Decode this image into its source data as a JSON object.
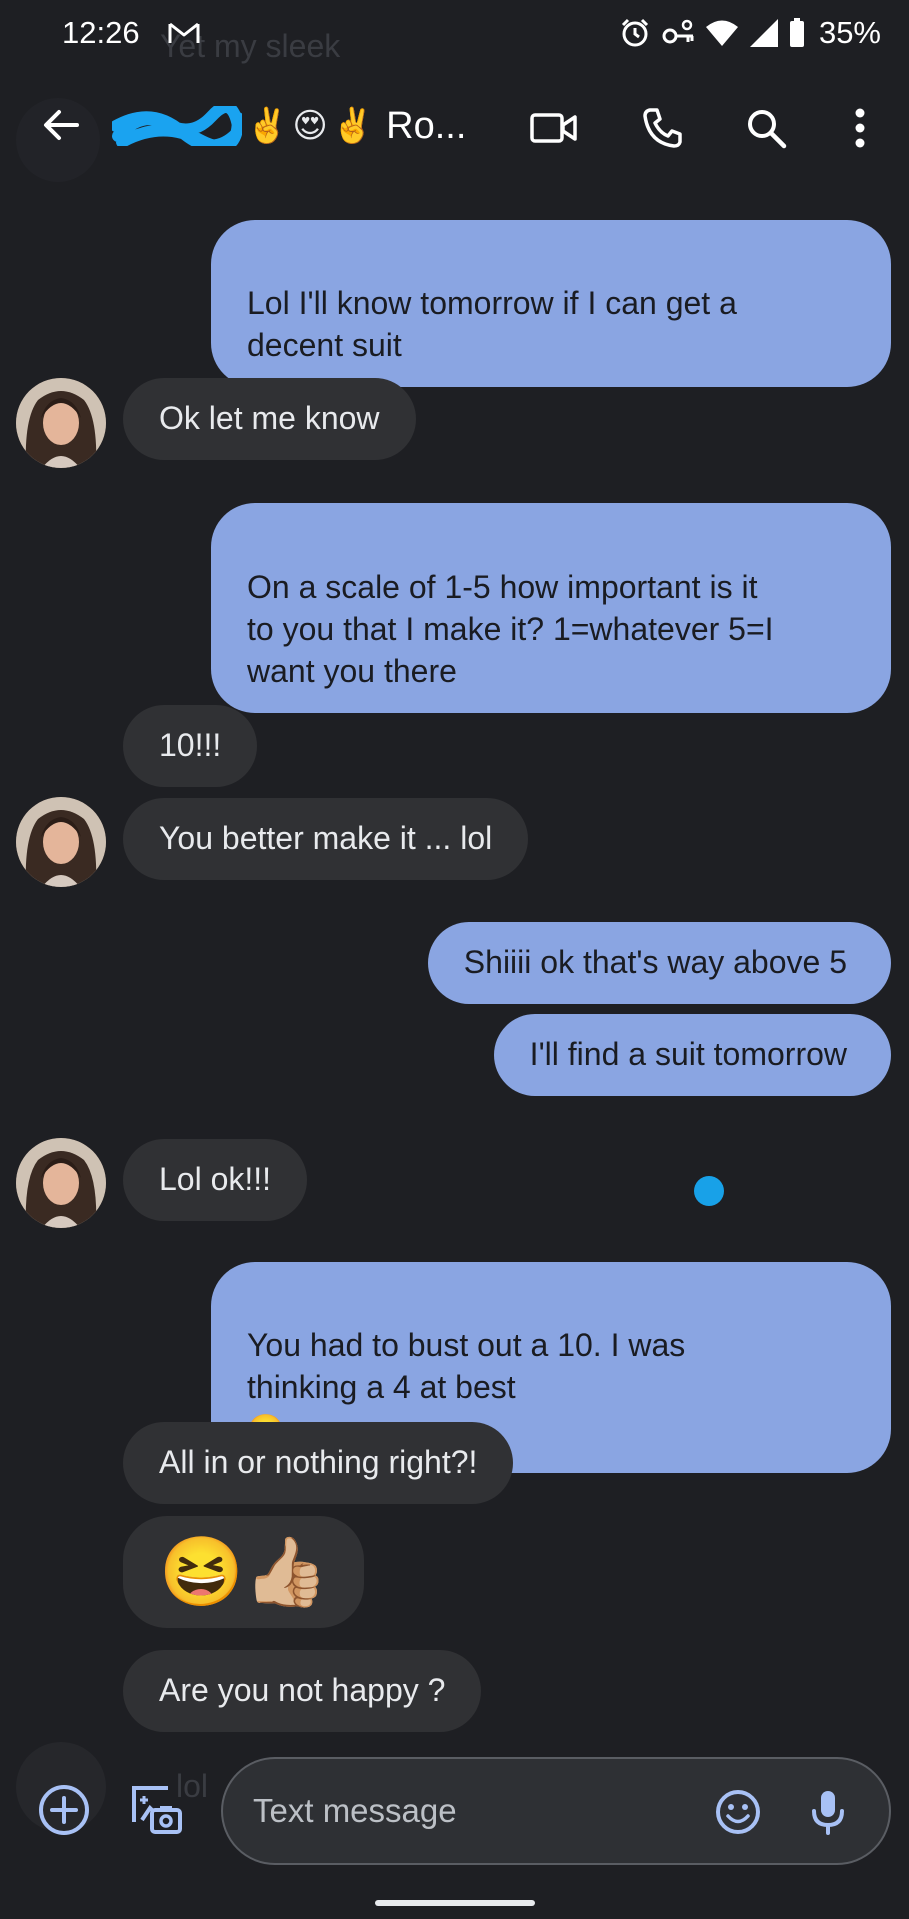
{
  "status_bar": {
    "time": "12:26",
    "battery": "35%",
    "icons": [
      "gmail-icon",
      "alarm-icon",
      "vpn-key-icon",
      "wifi-icon",
      "signal-icon",
      "battery-icon"
    ]
  },
  "header": {
    "ghost_text": "Yet my sleek",
    "contact_name": "Ro...",
    "name_emojis": [
      "✌️",
      "😍",
      "✌️"
    ],
    "icons": [
      "back-arrow-icon",
      "video-camera-icon",
      "phone-icon",
      "search-icon",
      "more-vert-icon"
    ]
  },
  "messages": [
    {
      "dir": "out",
      "text": "Lol I'll know tomorrow if I can get a\ndecent suit"
    },
    {
      "dir": "in",
      "text": "Ok let me know"
    },
    {
      "dir": "out",
      "text": "On a scale of 1-5 how important is it\nto you that I make it? 1=whatever 5=I\nwant you there"
    },
    {
      "dir": "in",
      "text": "10!!!"
    },
    {
      "dir": "in",
      "text": "You better make it ... lol"
    },
    {
      "dir": "out",
      "text": "Shiiii ok that's way above 5"
    },
    {
      "dir": "out",
      "text": "I'll find a suit tomorrow"
    },
    {
      "dir": "in",
      "text": "Lol ok!!!"
    },
    {
      "dir": "out",
      "text": "You had to bust out a 10. I was\nthinking a 4 at best",
      "emoji": "😜"
    },
    {
      "dir": "in",
      "text": "All in or nothing right?!"
    },
    {
      "dir": "in",
      "text": "😆👍🏼"
    },
    {
      "dir": "in",
      "text": "Are you not happy ?"
    }
  ],
  "composer": {
    "ghost_text": "lol",
    "placeholder": "Text message",
    "value": "",
    "icons": [
      "add-icon",
      "gallery-camera-icon",
      "emoji-icon",
      "mic-icon"
    ]
  },
  "colors": {
    "background": "#1e1f23",
    "incoming_bubble": "#303134",
    "outgoing_bubble": "#8aa5e2",
    "typing_dot": "#18a1e8",
    "redaction": "#1aa3f0",
    "icon_accent": "#a8c1f5"
  }
}
